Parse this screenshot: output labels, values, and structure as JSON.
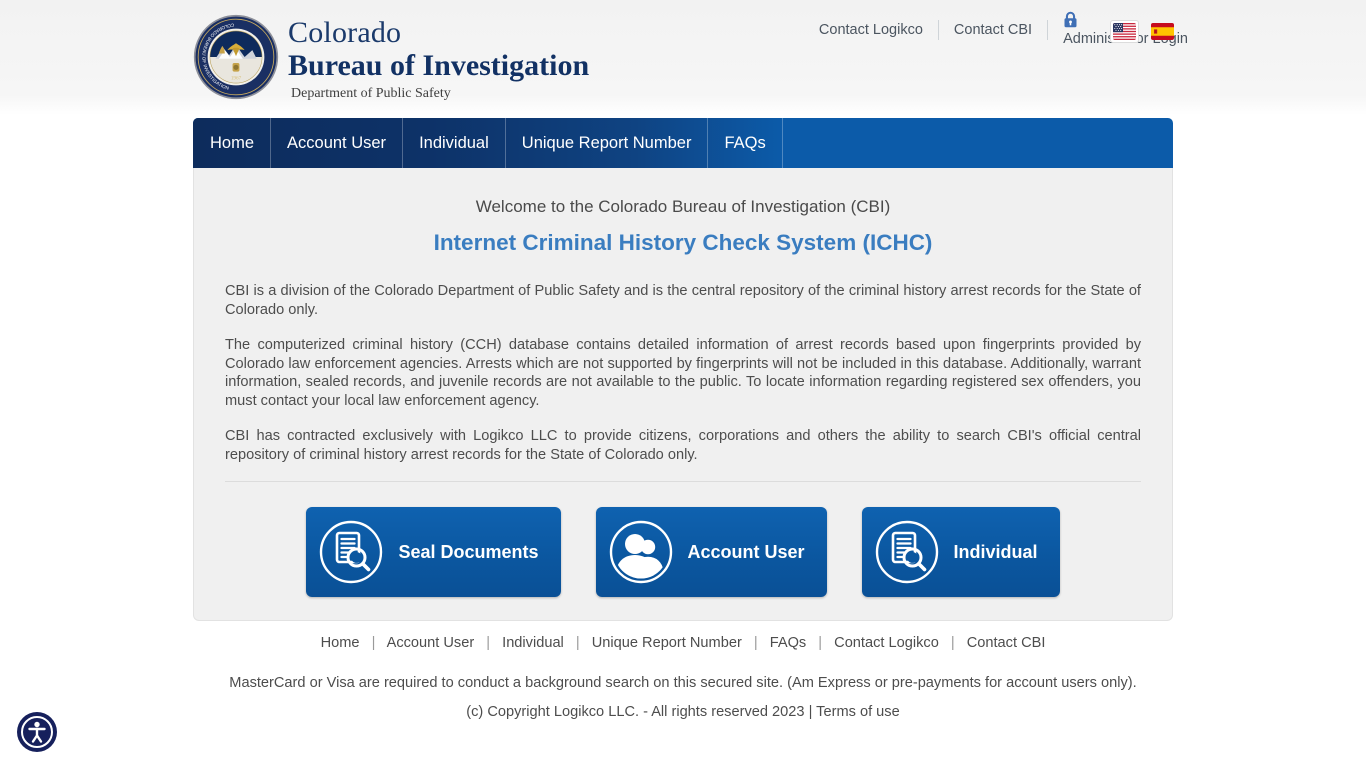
{
  "brand": {
    "line1": "Colorado",
    "line2": "Bureau of Investigation",
    "line3": "Department of Public Safety",
    "seal_icon": "cbi-seal-icon",
    "seal_ring_text": "COLORADO BUREAU OF INVESTIGATION",
    "seal_year": "1967"
  },
  "toplinks": {
    "contact_logikco": "Contact Logikco",
    "contact_cbi": "Contact CBI",
    "administrator_login": "Administrator Login",
    "lock_icon": "lock-icon",
    "flag_en_icon": "flag-us-icon",
    "flag_es_icon": "flag-spain-icon"
  },
  "nav": {
    "items": [
      {
        "label": "Home"
      },
      {
        "label": "Account User"
      },
      {
        "label": "Individual"
      },
      {
        "label": "Unique Report Number"
      },
      {
        "label": "FAQs"
      }
    ]
  },
  "main": {
    "welcome": "Welcome to the Colorado Bureau of Investigation (CBI)",
    "title": "Internet Criminal History Check System (ICHC)",
    "paragraphs": [
      "CBI is a division of the Colorado Department of Public Safety and is the central repository of the criminal history arrest records for the State of Colorado only.",
      "The computerized criminal history (CCH) database contains detailed information of arrest records based upon fingerprints provided by Colorado law enforcement agencies. Arrests which are not supported by fingerprints will not be included in this database. Additionally, warrant information, sealed records, and juvenile records are not available to the public. To locate information regarding registered sex offenders, you must contact your local law enforcement agency.",
      "CBI has contracted exclusively with Logikco LLC to provide citizens, corporations and others the ability to search CBI's official central repository of criminal history arrest records for the State of Colorado only."
    ],
    "buttons": [
      {
        "label": "Seal Documents",
        "icon": "document-search-icon"
      },
      {
        "label": "Account User",
        "icon": "users-icon"
      },
      {
        "label": "Individual",
        "icon": "document-search-icon"
      }
    ]
  },
  "footer": {
    "links": [
      "Home",
      "Account User",
      "Individual",
      "Unique Report Number",
      "FAQs",
      "Contact Logikco",
      "Contact CBI"
    ],
    "separator": "|",
    "note": "MasterCard or Visa are required to conduct a background search on this secured site. (Am Express or pre-payments for account users only).",
    "copyright": "(c) Copyright Logikco LLC. - All rights reserved 2023",
    "copyright_sep": "|",
    "terms": "Terms of use"
  },
  "accessibility": {
    "icon": "accessibility-person-icon"
  },
  "colors": {
    "nav_dark": "#0d2c5c",
    "nav_bright": "#0c5ba9",
    "brand_navy": "#123164",
    "accent_blue": "#3a7dc0",
    "button_blue": "#0b57a0",
    "panel_bg": "#f0f0f0",
    "text_gray": "#4d4d4d"
  }
}
